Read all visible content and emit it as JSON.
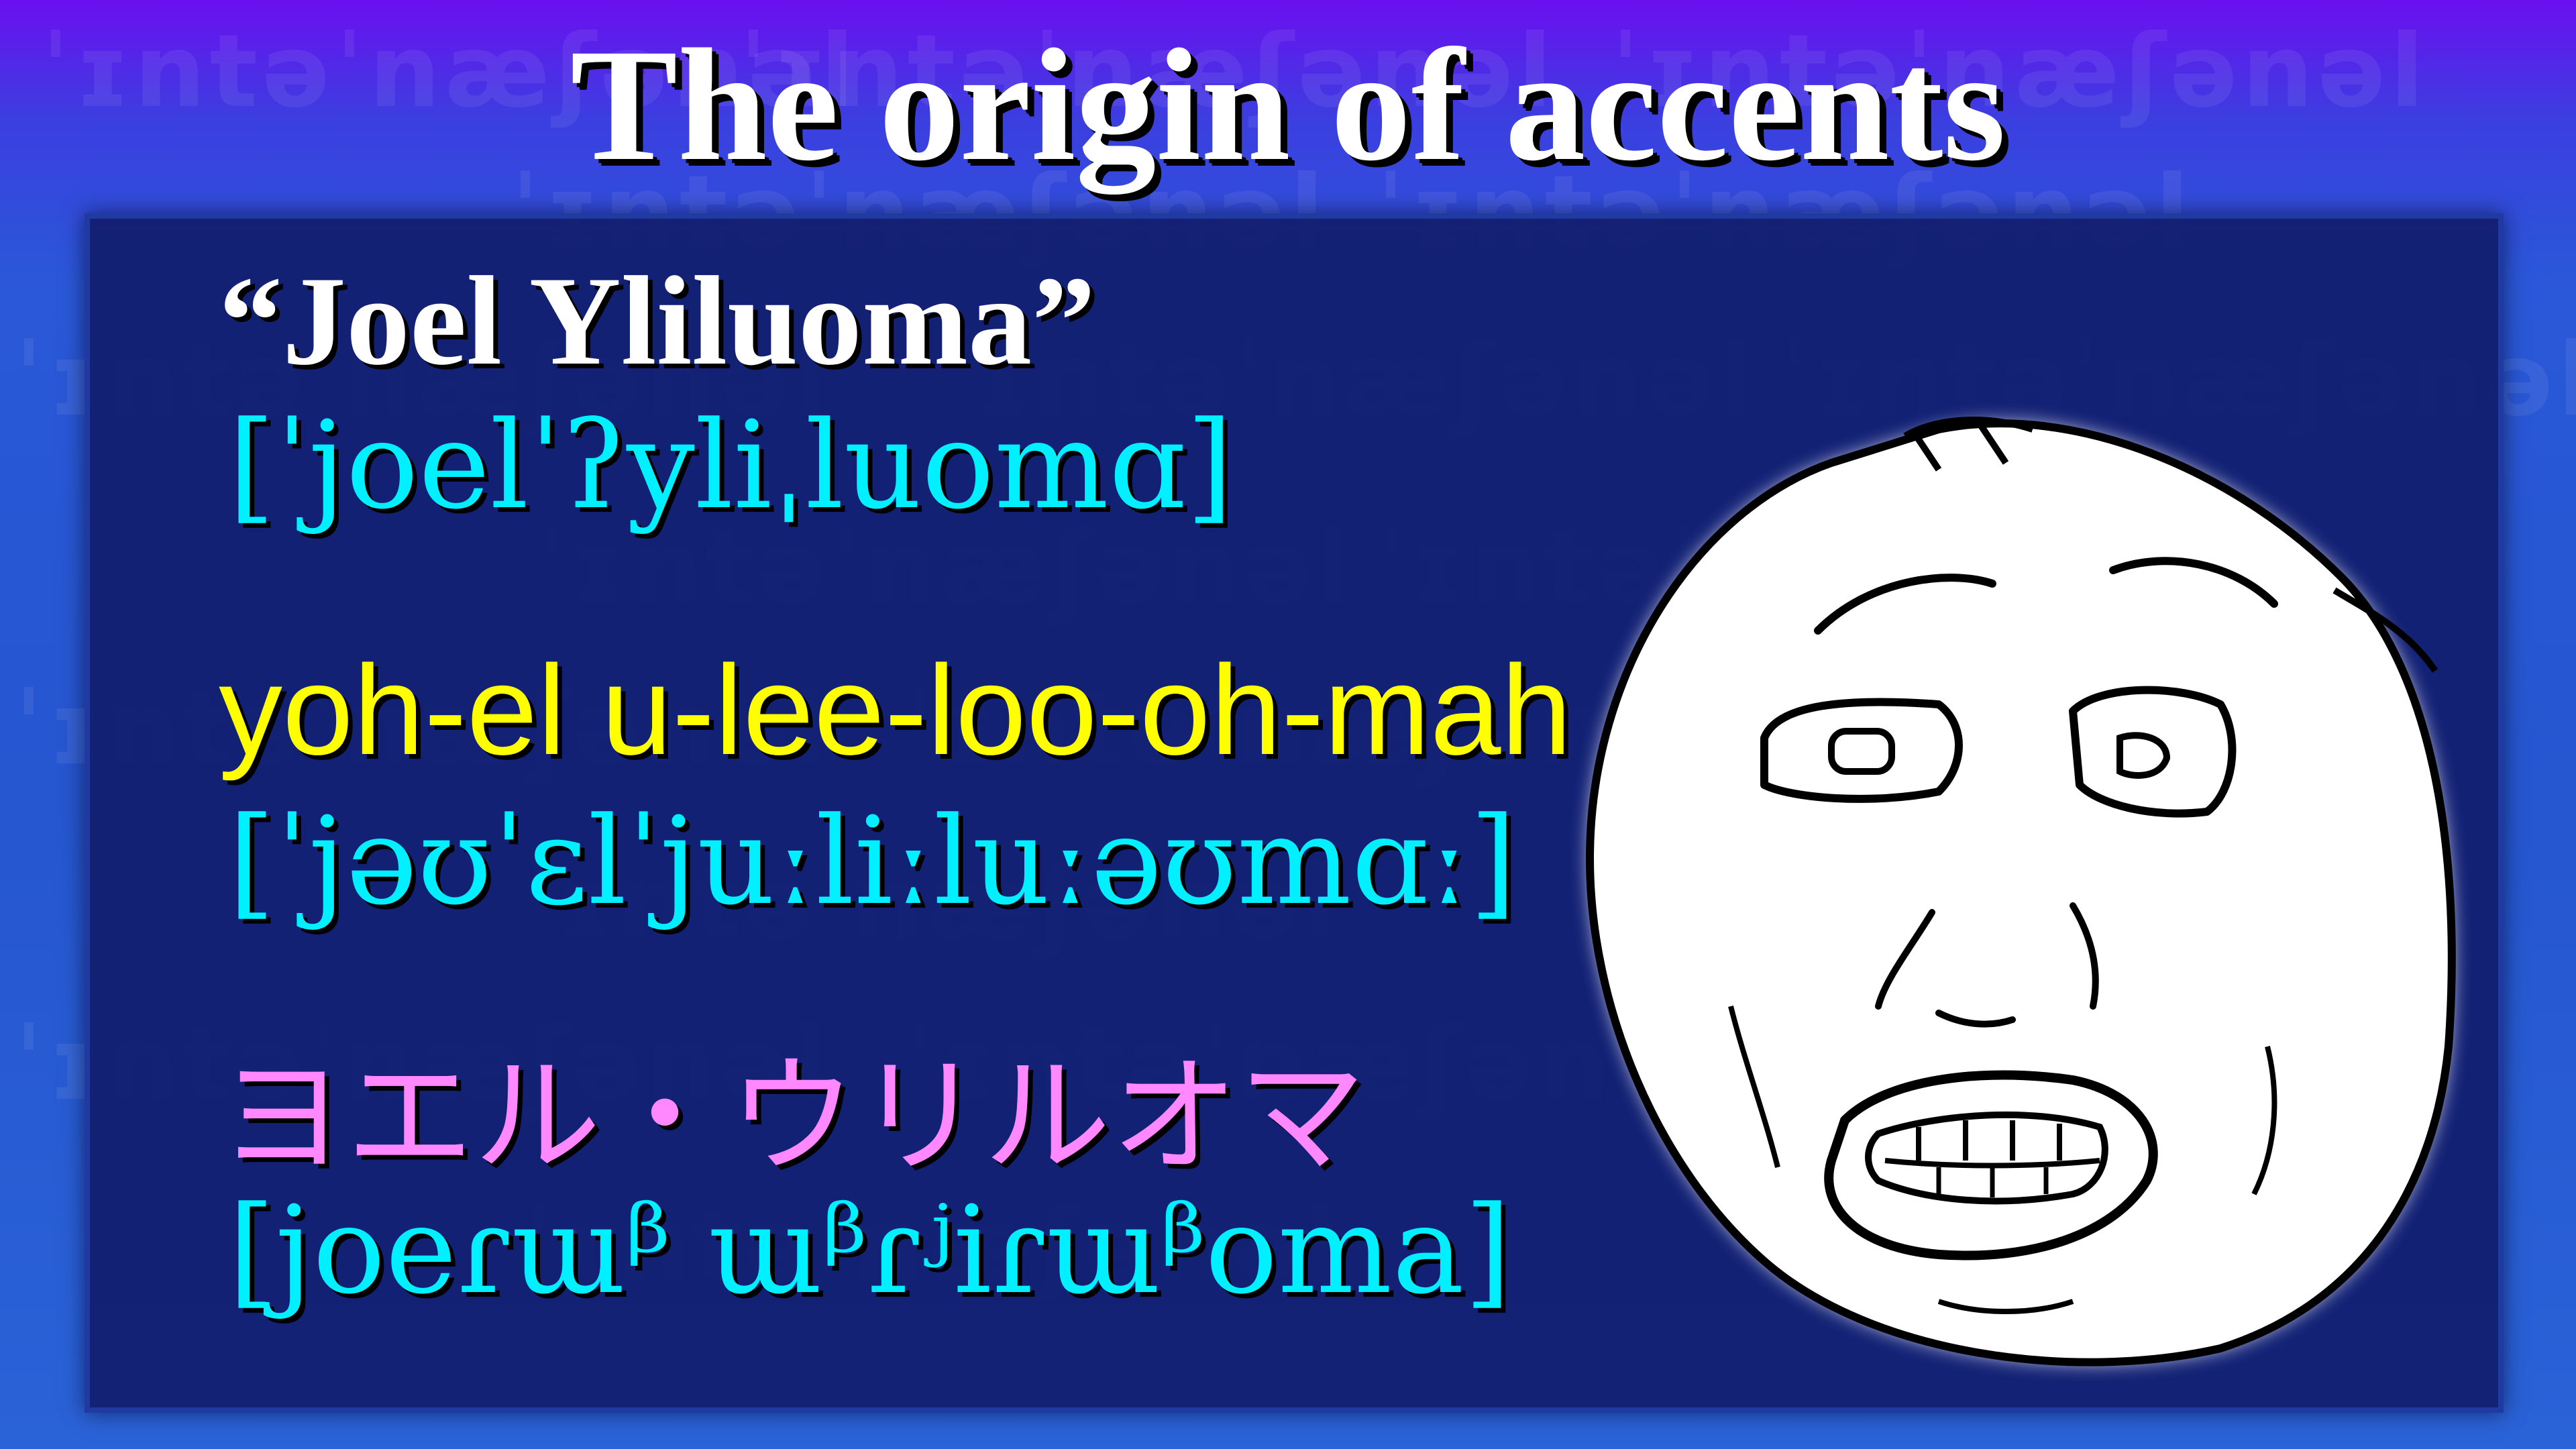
{
  "title": "The origin of accents",
  "watermark_text": "ˈɪntəˈnæʃənəl",
  "lines": {
    "original_name": "“Joel Yliluoma”",
    "original_ipa": "[ˈjoelˈʔyliˌluomɑ]",
    "english_spelling": "yoh-el u-lee-loo-oh-mah",
    "english_ipa": "[ˈjəʊˈɛlˈjuːliːluːəʊmɑː]",
    "japanese_spelling": "ヨエル・ウリルオマ",
    "japanese_ipa": "[joeɾɯᵝ ɯᵝɾʲiɾɯᵝoma]"
  },
  "colors": {
    "title": "#ffffff",
    "name": "#ffffff",
    "ipa": "#00f0ff",
    "english": "#ffff00",
    "japanese": "#ff88ff",
    "panel": "#121e6e"
  },
  "icons": {
    "face": "worried-rage-face"
  }
}
